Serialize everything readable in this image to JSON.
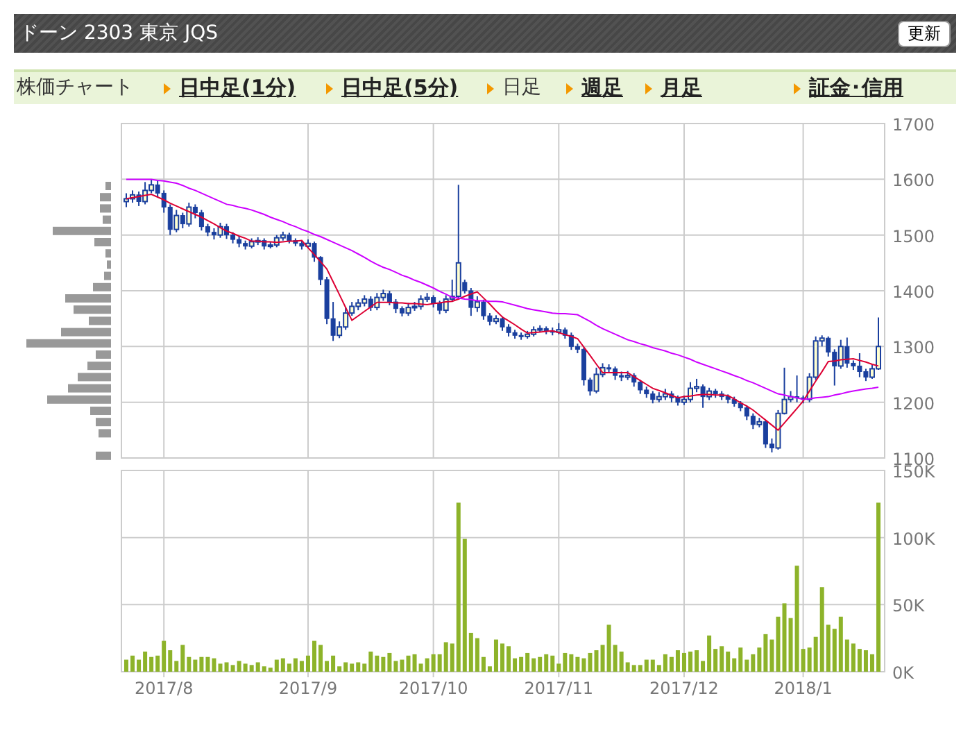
{
  "header": {
    "title": "ドーン 2303 東京 JQS",
    "refresh_button": "更新"
  },
  "nav": {
    "label": "株価チャート",
    "items": [
      {
        "label": "日中足(1分)",
        "selected": false
      },
      {
        "label": "日中足(5分)",
        "selected": false
      },
      {
        "label": "日足",
        "selected": true
      },
      {
        "label": "週足",
        "selected": false
      },
      {
        "label": "月足",
        "selected": false
      },
      {
        "label": "証金･信用",
        "selected": false
      }
    ]
  },
  "price_chart": {
    "chart_data": {
      "type": "candlestick",
      "grid": true,
      "ylim": [
        1100,
        1700
      ],
      "yticks": [
        1100,
        1200,
        1300,
        1400,
        1500,
        1600,
        1700
      ],
      "categories": [
        null,
        null,
        null,
        null,
        null,
        null,
        null,
        null,
        null,
        null,
        null,
        null,
        null,
        null,
        null,
        null,
        null,
        null,
        null,
        null,
        null,
        null,
        null,
        null,
        null,
        null,
        null,
        null,
        null,
        null,
        null,
        null,
        null,
        null,
        null,
        null,
        null,
        null,
        null,
        null,
        null,
        null,
        null,
        null,
        null,
        null,
        null,
        null,
        null,
        null,
        null,
        null,
        null,
        null,
        null,
        null,
        null,
        null,
        null,
        null,
        null,
        null,
        null,
        null,
        null,
        null,
        null,
        null,
        null,
        null,
        null,
        null,
        null,
        null,
        null,
        null,
        null,
        null,
        null,
        null,
        null,
        null,
        null,
        null,
        null,
        null,
        null,
        null,
        null,
        null,
        null,
        null,
        null,
        null,
        null,
        null,
        null,
        null,
        null,
        null,
        null,
        null,
        null,
        null,
        null,
        null,
        null,
        null,
        null,
        null,
        null,
        null,
        null,
        null,
        null,
        null,
        null,
        null,
        null,
        null,
        null
      ],
      "ohlc": [
        [
          1560,
          1575,
          1550,
          1565
        ],
        [
          1565,
          1580,
          1558,
          1572
        ],
        [
          1572,
          1578,
          1552,
          1560
        ],
        [
          1560,
          1595,
          1555,
          1580
        ],
        [
          1580,
          1600,
          1575,
          1590
        ],
        [
          1590,
          1598,
          1568,
          1575
        ],
        [
          1575,
          1580,
          1540,
          1550
        ],
        [
          1550,
          1555,
          1500,
          1510
        ],
        [
          1510,
          1545,
          1505,
          1535
        ],
        [
          1535,
          1540,
          1512,
          1520
        ],
        [
          1520,
          1558,
          1515,
          1550
        ],
        [
          1550,
          1555,
          1530,
          1540
        ],
        [
          1540,
          1545,
          1508,
          1515
        ],
        [
          1515,
          1520,
          1498,
          1505
        ],
        [
          1505,
          1512,
          1492,
          1500
        ],
        [
          1500,
          1522,
          1495,
          1515
        ],
        [
          1515,
          1520,
          1493,
          1500
        ],
        [
          1500,
          1505,
          1485,
          1492
        ],
        [
          1492,
          1498,
          1478,
          1485
        ],
        [
          1485,
          1490,
          1474,
          1480
        ],
        [
          1480,
          1494,
          1476,
          1488
        ],
        [
          1488,
          1496,
          1482,
          1490
        ],
        [
          1490,
          1494,
          1474,
          1480
        ],
        [
          1480,
          1488,
          1476,
          1482
        ],
        [
          1482,
          1500,
          1478,
          1495
        ],
        [
          1495,
          1506,
          1490,
          1500
        ],
        [
          1500,
          1504,
          1485,
          1490
        ],
        [
          1490,
          1494,
          1480,
          1485
        ],
        [
          1485,
          1490,
          1474,
          1480
        ],
        [
          1480,
          1492,
          1476,
          1485
        ],
        [
          1485,
          1488,
          1452,
          1460
        ],
        [
          1460,
          1462,
          1410,
          1420
        ],
        [
          1420,
          1425,
          1340,
          1350
        ],
        [
          1350,
          1380,
          1310,
          1320
        ],
        [
          1320,
          1345,
          1315,
          1335
        ],
        [
          1335,
          1370,
          1330,
          1360
        ],
        [
          1360,
          1380,
          1355,
          1372
        ],
        [
          1372,
          1385,
          1365,
          1378
        ],
        [
          1378,
          1392,
          1372,
          1385
        ],
        [
          1385,
          1390,
          1364,
          1370
        ],
        [
          1370,
          1396,
          1365,
          1388
        ],
        [
          1388,
          1402,
          1382,
          1395
        ],
        [
          1395,
          1400,
          1374,
          1380
        ],
        [
          1380,
          1385,
          1360,
          1368
        ],
        [
          1368,
          1372,
          1354,
          1360
        ],
        [
          1360,
          1378,
          1355,
          1370
        ],
        [
          1370,
          1380,
          1364,
          1372
        ],
        [
          1372,
          1392,
          1366,
          1385
        ],
        [
          1385,
          1396,
          1380,
          1388
        ],
        [
          1388,
          1392,
          1370,
          1378
        ],
        [
          1378,
          1382,
          1358,
          1365
        ],
        [
          1365,
          1392,
          1360,
          1385
        ],
        [
          1385,
          1420,
          1380,
          1390
        ],
        [
          1390,
          1590,
          1385,
          1450
        ],
        [
          1415,
          1420,
          1395,
          1400
        ],
        [
          1400,
          1405,
          1355,
          1370
        ],
        [
          1370,
          1390,
          1362,
          1380
        ],
        [
          1380,
          1384,
          1348,
          1355
        ],
        [
          1355,
          1360,
          1338,
          1345
        ],
        [
          1345,
          1356,
          1340,
          1350
        ],
        [
          1350,
          1354,
          1328,
          1335
        ],
        [
          1335,
          1340,
          1318,
          1325
        ],
        [
          1325,
          1330,
          1314,
          1320
        ],
        [
          1320,
          1325,
          1312,
          1318
        ],
        [
          1318,
          1328,
          1314,
          1322
        ],
        [
          1322,
          1336,
          1318,
          1330
        ],
        [
          1330,
          1338,
          1326,
          1332
        ],
        [
          1332,
          1336,
          1322,
          1328
        ],
        [
          1328,
          1334,
          1320,
          1326
        ],
        [
          1326,
          1342,
          1322,
          1330
        ],
        [
          1330,
          1334,
          1314,
          1320
        ],
        [
          1320,
          1325,
          1294,
          1300
        ],
        [
          1300,
          1305,
          1288,
          1295
        ],
        [
          1295,
          1298,
          1230,
          1240
        ],
        [
          1240,
          1244,
          1212,
          1220
        ],
        [
          1220,
          1262,
          1216,
          1250
        ],
        [
          1250,
          1270,
          1245,
          1262
        ],
        [
          1262,
          1268,
          1252,
          1260
        ],
        [
          1260,
          1264,
          1240,
          1248
        ],
        [
          1248,
          1255,
          1238,
          1245
        ],
        [
          1245,
          1256,
          1240,
          1248
        ],
        [
          1248,
          1252,
          1228,
          1236
        ],
        [
          1236,
          1240,
          1215,
          1222
        ],
        [
          1222,
          1228,
          1208,
          1215
        ],
        [
          1215,
          1220,
          1198,
          1205
        ],
        [
          1205,
          1218,
          1200,
          1210
        ],
        [
          1210,
          1224,
          1204,
          1215
        ],
        [
          1215,
          1220,
          1200,
          1208
        ],
        [
          1208,
          1212,
          1194,
          1200
        ],
        [
          1200,
          1212,
          1195,
          1205
        ],
        [
          1205,
          1236,
          1200,
          1225
        ],
        [
          1225,
          1242,
          1218,
          1228
        ],
        [
          1228,
          1232,
          1190,
          1210
        ],
        [
          1210,
          1226,
          1204,
          1220
        ],
        [
          1220,
          1224,
          1208,
          1215
        ],
        [
          1215,
          1220,
          1204,
          1210
        ],
        [
          1210,
          1214,
          1198,
          1205
        ],
        [
          1205,
          1210,
          1192,
          1198
        ],
        [
          1198,
          1202,
          1184,
          1190
        ],
        [
          1190,
          1194,
          1168,
          1175
        ],
        [
          1175,
          1180,
          1152,
          1160
        ],
        [
          1160,
          1172,
          1155,
          1165
        ],
        [
          1165,
          1168,
          1118,
          1125
        ],
        [
          1125,
          1135,
          1110,
          1118
        ],
        [
          1118,
          1186,
          1115,
          1180
        ],
        [
          1180,
          1262,
          1178,
          1205
        ],
        [
          1205,
          1220,
          1200,
          1210
        ],
        [
          1210,
          1248,
          1200,
          1208
        ],
        [
          1208,
          1212,
          1198,
          1205
        ],
        [
          1205,
          1252,
          1200,
          1245
        ],
        [
          1245,
          1318,
          1240,
          1310
        ],
        [
          1310,
          1320,
          1300,
          1315
        ],
        [
          1315,
          1318,
          1282,
          1290
        ],
        [
          1290,
          1295,
          1230,
          1265
        ],
        [
          1265,
          1312,
          1260,
          1300
        ],
        [
          1300,
          1316,
          1262,
          1270
        ],
        [
          1270,
          1275,
          1258,
          1265
        ],
        [
          1265,
          1288,
          1245,
          1255
        ],
        [
          1255,
          1260,
          1238,
          1245
        ],
        [
          1245,
          1268,
          1242,
          1260
        ],
        [
          1260,
          1352,
          1258,
          1300
        ]
      ],
      "series": [
        {
          "type": "line",
          "color": "#dd0033",
          "values": [
            1565,
            1567,
            1569,
            1571,
            1573,
            1568,
            1563,
            1557,
            1552,
            1547,
            1542,
            1537,
            1532,
            1526,
            1520,
            1513,
            1507,
            1503,
            1498,
            1494,
            1489,
            1489,
            1488,
            1488,
            1487,
            1488,
            1489,
            1489,
            1490,
            1477,
            1465,
            1452,
            1439,
            1416,
            1393,
            1370,
            1347,
            1355,
            1363,
            1371,
            1379,
            1379,
            1379,
            1378,
            1378,
            1377,
            1377,
            1376,
            1375,
            1377,
            1378,
            1380,
            1381,
            1385,
            1390,
            1394,
            1398,
            1387,
            1376,
            1364,
            1353,
            1346,
            1339,
            1331,
            1324,
            1325,
            1326,
            1327,
            1328,
            1325,
            1321,
            1318,
            1314,
            1299,
            1284,
            1268,
            1253,
            1253,
            1253,
            1253,
            1253,
            1246,
            1239,
            1232,
            1225,
            1221,
            1217,
            1212,
            1208,
            1210,
            1211,
            1213,
            1214,
            1214,
            1213,
            1213,
            1212,
            1206,
            1199,
            1193,
            1186,
            1177,
            1168,
            1159,
            1150,
            1163,
            1176,
            1189,
            1202,
            1220,
            1238,
            1255,
            1273,
            1274,
            1276,
            1277,
            1278,
            1275,
            1272,
            1268,
            1265
          ]
        },
        {
          "type": "line",
          "color": "#cc00ff",
          "values": [
            1600,
            1600,
            1600,
            1600,
            1600,
            1598,
            1597,
            1595,
            1593,
            1589,
            1584,
            1580,
            1575,
            1570,
            1565,
            1560,
            1555,
            1553,
            1550,
            1548,
            1545,
            1541,
            1537,
            1532,
            1528,
            1524,
            1519,
            1515,
            1510,
            1506,
            1501,
            1497,
            1492,
            1487,
            1482,
            1477,
            1472,
            1466,
            1460,
            1453,
            1447,
            1442,
            1438,
            1433,
            1428,
            1424,
            1419,
            1415,
            1410,
            1405,
            1399,
            1394,
            1388,
            1387,
            1385,
            1384,
            1382,
            1382,
            1381,
            1381,
            1380,
            1377,
            1374,
            1371,
            1368,
            1366,
            1364,
            1362,
            1360,
            1359,
            1359,
            1358,
            1357,
            1351,
            1345,
            1338,
            1332,
            1327,
            1322,
            1317,
            1312,
            1309,
            1305,
            1302,
            1298,
            1295,
            1292,
            1288,
            1285,
            1281,
            1277,
            1272,
            1268,
            1264,
            1260,
            1256,
            1252,
            1248,
            1244,
            1239,
            1235,
            1230,
            1225,
            1220,
            1215,
            1213,
            1210,
            1208,
            1205,
            1206,
            1208,
            1209,
            1210,
            1213,
            1215,
            1218,
            1220,
            1222,
            1224,
            1225,
            1227
          ]
        }
      ]
    }
  },
  "volume_chart": {
    "chart_data": {
      "type": "bar",
      "grid": true,
      "ylim": [
        0,
        150
      ],
      "yticks": [
        {
          "value": 0,
          "label": "0K"
        },
        {
          "value": 50,
          "label": "50K"
        },
        {
          "value": 100,
          "label": "100K"
        },
        {
          "value": 150,
          "label": "150K"
        }
      ],
      "categories": [
        null,
        null,
        null,
        null,
        null,
        null,
        "2017/8",
        null,
        null,
        null,
        null,
        null,
        null,
        null,
        null,
        null,
        null,
        null,
        null,
        null,
        null,
        null,
        null,
        null,
        null,
        null,
        null,
        null,
        null,
        "2017/9",
        null,
        null,
        null,
        null,
        null,
        null,
        null,
        null,
        null,
        null,
        null,
        null,
        null,
        null,
        null,
        null,
        null,
        null,
        null,
        "2017/10",
        null,
        null,
        null,
        null,
        null,
        null,
        null,
        null,
        null,
        null,
        null,
        null,
        null,
        null,
        null,
        null,
        null,
        null,
        null,
        "2017/11",
        null,
        null,
        null,
        null,
        null,
        null,
        null,
        null,
        null,
        null,
        null,
        null,
        null,
        null,
        null,
        null,
        null,
        null,
        null,
        "2017/12",
        null,
        null,
        null,
        null,
        null,
        null,
        null,
        null,
        null,
        null,
        null,
        null,
        null,
        null,
        null,
        null,
        null,
        null,
        "2018/1",
        null,
        null,
        null,
        null,
        null,
        null,
        null,
        null,
        null,
        null,
        null,
        null
      ],
      "series": [
        {
          "color": "#8db32a",
          "values": [
            9,
            12,
            9,
            15,
            11,
            12,
            23,
            16,
            8,
            20,
            11,
            9,
            11,
            11,
            10,
            6,
            7,
            5,
            8,
            6,
            5,
            7,
            4,
            3,
            9,
            10,
            6,
            10,
            8,
            12,
            23,
            20,
            8,
            12,
            4,
            7,
            6,
            7,
            6,
            15,
            12,
            11,
            14,
            8,
            9,
            12,
            13,
            6,
            10,
            13,
            13,
            22,
            21,
            126,
            99,
            29,
            25,
            11,
            4,
            24,
            21,
            19,
            10,
            11,
            14,
            10,
            11,
            13,
            12,
            6,
            14,
            13,
            11,
            10,
            14,
            16,
            20,
            35,
            20,
            15,
            7,
            5,
            5,
            9,
            9,
            5,
            13,
            11,
            16,
            14,
            15,
            16,
            8,
            27,
            17,
            19,
            15,
            10,
            18,
            9,
            13,
            18,
            28,
            24,
            41,
            51,
            40,
            79,
            17,
            18,
            26,
            63,
            35,
            32,
            41,
            24,
            21,
            17,
            16,
            13,
            126
          ]
        }
      ]
    }
  }
}
